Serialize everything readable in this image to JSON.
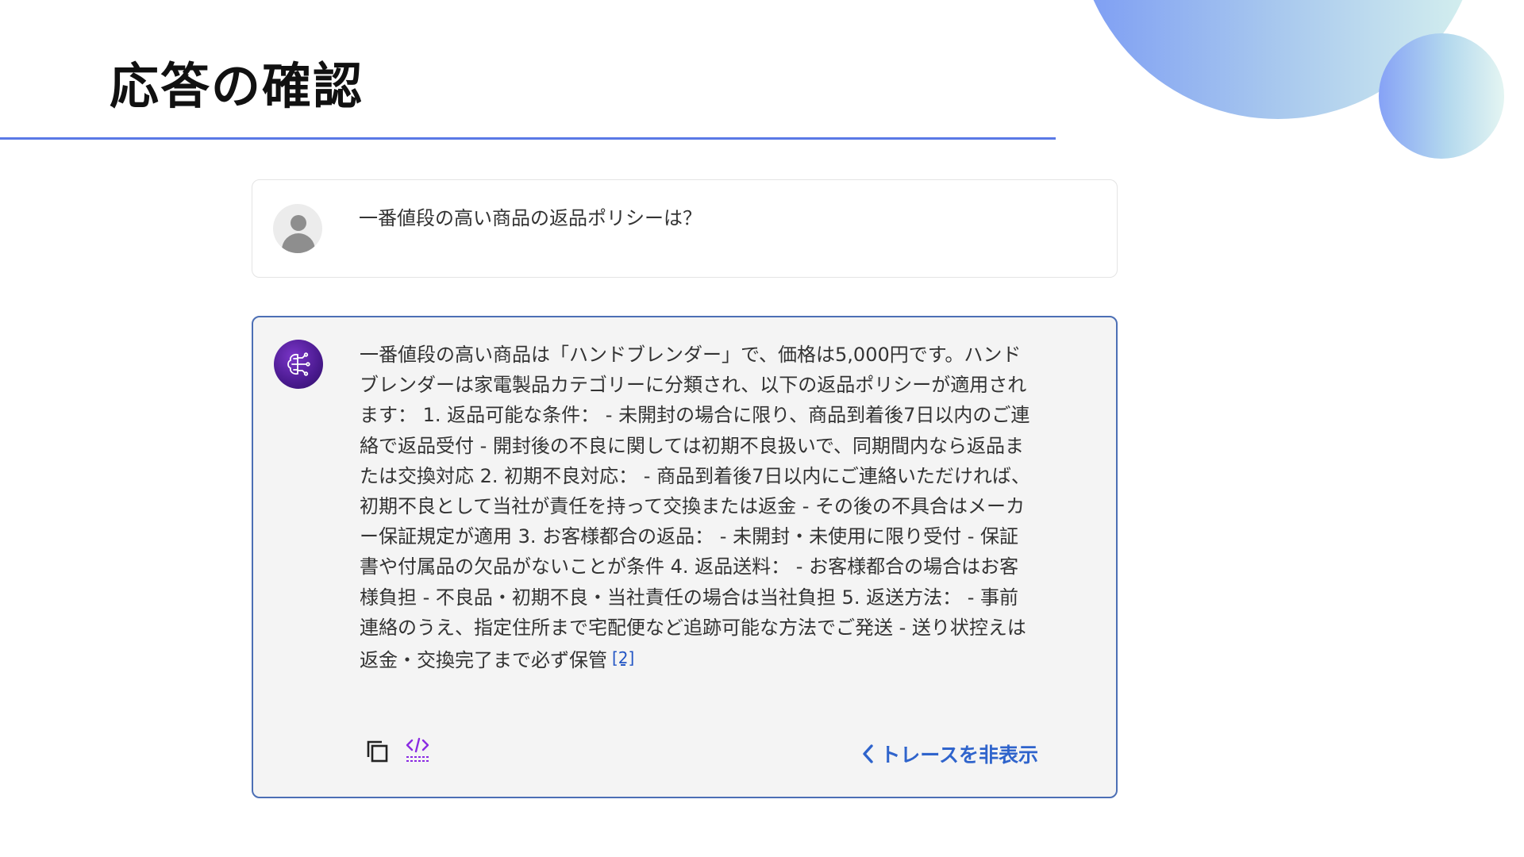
{
  "slide": {
    "title": "応答の確認"
  },
  "chat": {
    "user_message": "一番値段の高い商品の返品ポリシーは？",
    "assistant_message": "一番値段の高い商品は「ハンドブレンダー」で、価格は5,000円です。ハンドブレンダーは家電製品カテゴリーに分類され、以下の返品ポリシーが適用されます： 1. 返品可能な条件： - 未開封の場合に限り、商品到着後7日以内のご連絡で返品受付 - 開封後の不良に関しては初期不良扱いで、同期間内なら返品または交換対応 2. 初期不良対応： - 商品到着後7日以内にご連絡いただければ、初期不良として当社が責任を持って交換または返金 - その後の不具合はメーカー保証規定が適用 3. お客様都合の返品： - 未開封・未使用に限り受付 - 保証書や付属品の欠品がないことが条件 4. 返品送料： - お客様都合の場合はお客様負担 - 不良品・初期不良・当社責任の場合は当社負担 5. 返送方法： - 事前連絡のうえ、指定住所まで宅配便など追跡可能な方法でご発送 - 送り状控えは返金・交換完了まで必ず保管",
    "citation": "[2]",
    "trace_toggle_label": "トレースを非表示"
  },
  "icons": {
    "user_avatar": "person-icon",
    "assistant_avatar": "ai-brain-icon",
    "copy": "copy-icon",
    "code": "code-icon",
    "toggle": "chevron-left-icon"
  },
  "colors": {
    "accent_rule": "#5a79e6",
    "card_border": "#4c6fb5",
    "link": "#2f64cc",
    "code_icon": "#8a2be2"
  }
}
